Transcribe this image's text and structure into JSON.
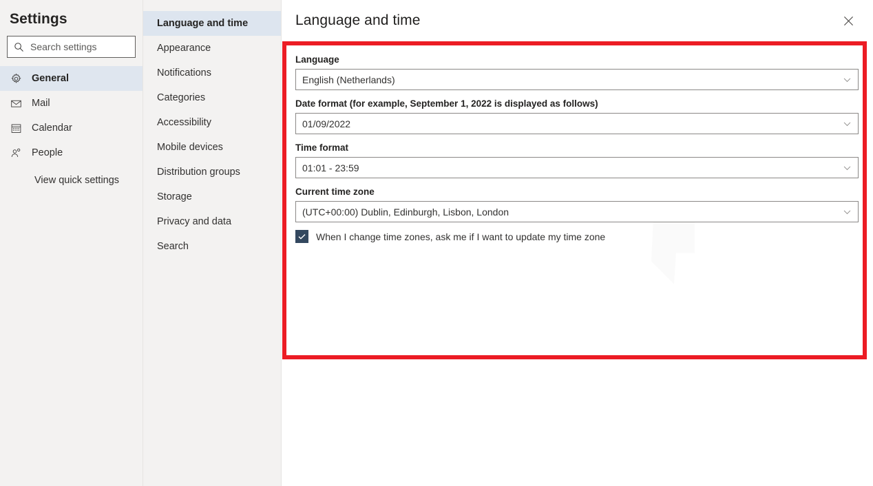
{
  "sidebar": {
    "title": "Settings",
    "search": {
      "placeholder": "Search settings",
      "value": "",
      "icon": "search-icon"
    },
    "items": [
      {
        "label": "General",
        "icon": "gear-icon",
        "selected": true
      },
      {
        "label": "Mail",
        "icon": "envelope-icon",
        "selected": false
      },
      {
        "label": "Calendar",
        "icon": "calendar-icon",
        "selected": false
      },
      {
        "label": "People",
        "icon": "person-icon",
        "selected": false
      }
    ],
    "quick_settings_label": "View quick settings"
  },
  "categories": {
    "items": [
      {
        "label": "Language and time",
        "selected": true
      },
      {
        "label": "Appearance",
        "selected": false
      },
      {
        "label": "Notifications",
        "selected": false
      },
      {
        "label": "Categories",
        "selected": false
      },
      {
        "label": "Accessibility",
        "selected": false
      },
      {
        "label": "Mobile devices",
        "selected": false
      },
      {
        "label": "Distribution groups",
        "selected": false
      },
      {
        "label": "Storage",
        "selected": false
      },
      {
        "label": "Privacy and data",
        "selected": false
      },
      {
        "label": "Search",
        "selected": false
      }
    ]
  },
  "detail": {
    "title": "Language and time",
    "close_icon": "close-icon",
    "fields": {
      "language": {
        "label": "Language",
        "value": "English (Netherlands)"
      },
      "date_format": {
        "label": "Date format (for example, September 1, 2022 is displayed as follows)",
        "value": "01/09/2022"
      },
      "time_format": {
        "label": "Time format",
        "value": "01:01 - 23:59"
      },
      "time_zone": {
        "label": "Current time zone",
        "value": "(UTC+00:00) Dublin, Edinburgh, Lisbon, London"
      }
    },
    "checkbox": {
      "label": "When I change time zones, ask me if I want to update my time zone",
      "checked": true
    }
  },
  "annotation": {
    "color": "#ec1c24"
  },
  "colors": {
    "sidebar_bg": "#f3f2f1",
    "selected_nav": "#dfe6ef",
    "selected_category": "#dde5ef",
    "checkbox_fill": "#33485f",
    "field_border": "#8a8886",
    "text_primary": "#323130"
  }
}
